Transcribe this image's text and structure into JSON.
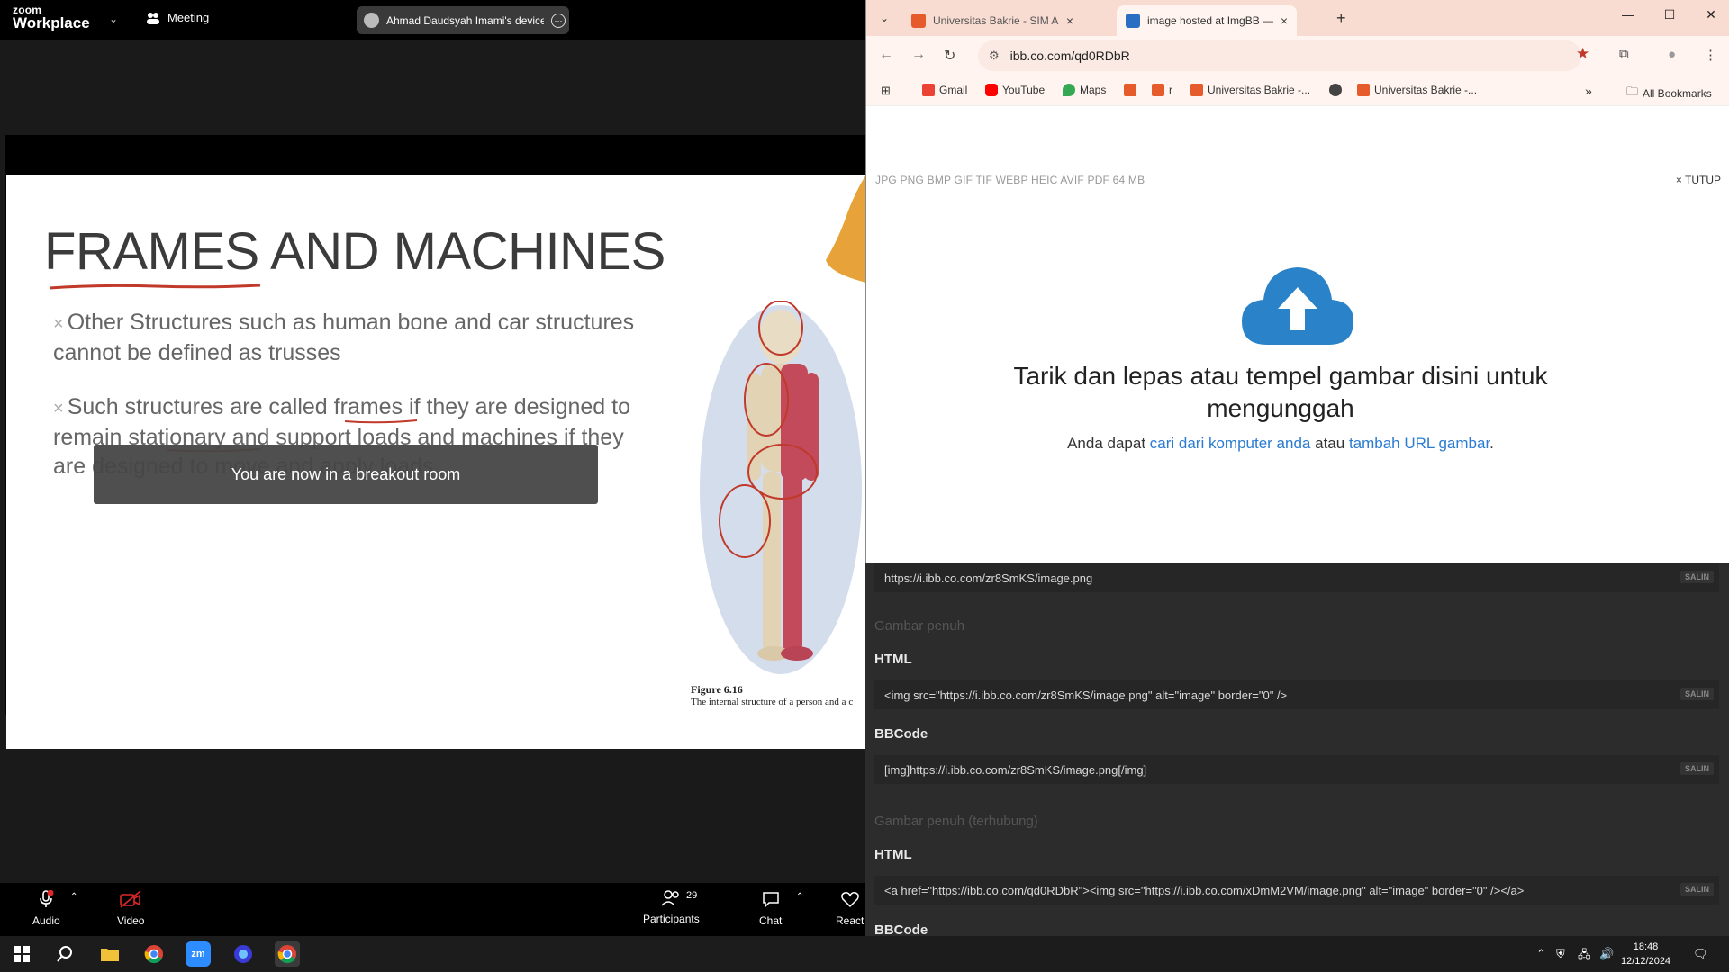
{
  "zoom": {
    "logo_line1": "zoom",
    "logo_line2": "Workplace",
    "meeting_label": "Meeting",
    "share_owner": "Ahmad Daudsyah Imami's device",
    "slide": {
      "title": "FRAMES AND MACHINES",
      "bullet1": "Other Structures such as human bone and car structures cannot be defined as trusses",
      "bullet2": "Such structures are called frames if they are designed to remain stationary and support loads and machines if they are designed to move and apply loads.",
      "figure_label": "Figure 6.16",
      "figure_caption": "The internal structure of a person and a c"
    },
    "toast": "You are now in a breakout room",
    "controls": {
      "audio": "Audio",
      "video": "Video",
      "participants": "Participants",
      "participants_count": "29",
      "chat": "Chat",
      "react": "React"
    }
  },
  "chrome": {
    "tabs": [
      {
        "title": "Universitas Bakrie - SIM Akademik",
        "active": false
      },
      {
        "title": "image hosted at ImgBB — ImgBB",
        "active": true
      }
    ],
    "url": "ibb.co.com/qd0RDbR",
    "bookmarks": [
      "Gmail",
      "YouTube",
      "Maps",
      "r",
      "Universitas Bakrie -...",
      "Universitas Bakrie -..."
    ],
    "all_bookmarks": "All Bookmarks"
  },
  "imgbb": {
    "formats": "JPG PNG BMP GIF TIF WEBP HEIC AVIF PDF   64 MB",
    "close": "× TUTUP",
    "drop_title": "Tarik dan lepas atau tempel gambar disini untuk mengunggah",
    "drop_sub_prefix": "Anda dapat",
    "drop_sub_link1": "cari dari komputer anda",
    "drop_sub_mid": "atau",
    "drop_sub_link2": "tambah URL gambar",
    "drop_sub_end": ".",
    "codes": {
      "direct_link": "https://i.ibb.co.com/zr8SmKS/image.png",
      "section_full": "Gambar penuh",
      "html_label": "HTML",
      "html_full": "<img src=\"https://i.ibb.co.com/zr8SmKS/image.png\" alt=\"image\" border=\"0\" />",
      "bbcode_label": "BBCode",
      "bbcode_full": "[img]https://i.ibb.co.com/zr8SmKS/image.png[/img]",
      "section_linked": "Gambar penuh (terhubung)",
      "html_linked": "<a href=\"https://ibb.co.com/qd0RDbR\"><img src=\"https://i.ibb.co.com/xDmM2VM/image.png\" alt=\"image\" border=\"0\" /></a>",
      "copy": "SALIN"
    }
  },
  "taskbar": {
    "time": "18:48",
    "date": "12/12/2024"
  }
}
